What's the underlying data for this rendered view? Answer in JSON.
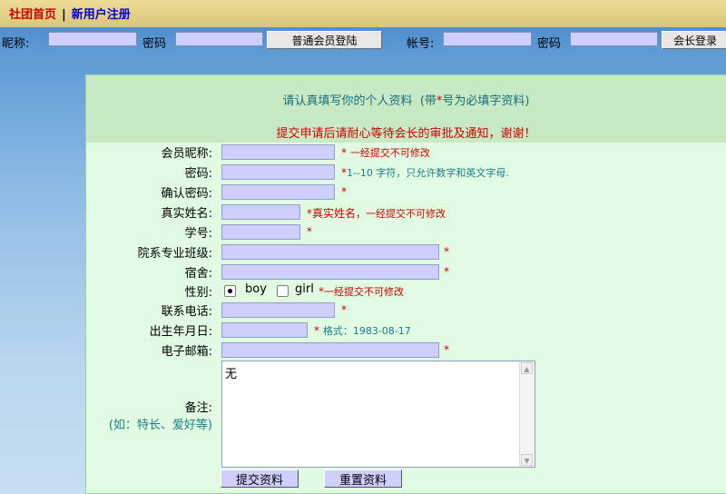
{
  "nav": {
    "home": "社团首页",
    "separator": "|",
    "register": "新用户注册"
  },
  "login": {
    "nickname_label": "昵称:",
    "password_label": "密码",
    "member_login": "普通会员登陆",
    "account_label": "帐号:",
    "password_label2": "密码",
    "leader_login": "会长登录"
  },
  "form": {
    "header_line1_a": "请认真填写你的个人资料",
    "header_line1_b": "(带",
    "header_star": "*",
    "header_line1_c": "号为必填字资料)",
    "header_line2": "提交申请后请耐心等待会长的审批及通知，谢谢！",
    "fields": {
      "nickname": {
        "label": "会员昵称:",
        "star": "*",
        "hint": "一经提交不可修改"
      },
      "password": {
        "label": "密码:",
        "star": "*",
        "hint": "1--10 字符，只允许数字和英文字母."
      },
      "confirm": {
        "label": "确认密码:",
        "star": "*"
      },
      "realname": {
        "label": "真实姓名:",
        "star": "*",
        "hint_a": "真实姓名",
        "hint_b": "，一经提交不可修改"
      },
      "student_id": {
        "label": "学号:",
        "star": "*"
      },
      "department": {
        "label": "院系专业班级:",
        "star": "*"
      },
      "dorm": {
        "label": "宿舍:",
        "star": "*"
      },
      "gender": {
        "label": "性别:",
        "boy": "boy",
        "girl": "girl",
        "star": "*",
        "hint": "一经提交不可修改"
      },
      "phone": {
        "label": "联系电话:",
        "star": "*"
      },
      "birthday": {
        "label": "出生年月日:",
        "star": "*",
        "hint": "格式：1983-08-17"
      },
      "email": {
        "label": "电子邮箱:",
        "star": "*"
      },
      "remarks": {
        "label": "备注:",
        "sublabel": "(如：特长、爱好等)",
        "value": "无"
      }
    },
    "submit": "提交资料",
    "reset": "重置资料"
  }
}
